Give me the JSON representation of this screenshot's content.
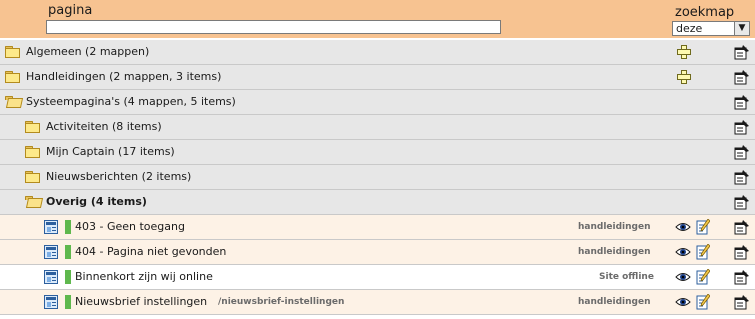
{
  "header": {
    "pagina_label": "pagina",
    "pagina_value": "",
    "zoekmap_label": "zoekmap",
    "zoekmap_value": "deze"
  },
  "rows": [
    {
      "label": "Algemeen (2 mappen)",
      "add": true
    },
    {
      "label": "Handleidingen (2 mappen, 3 items)",
      "add": true
    },
    {
      "label": "Systeempagina's (4 mappen, 5 items)",
      "add": false
    },
    {
      "label": "Activiteiten (8 items)"
    },
    {
      "label": "Mijn Captain (17 items)"
    },
    {
      "label": "Nieuwsberichten (2 items)"
    },
    {
      "label": "Overig (4 items)"
    },
    {
      "label": "403 - Geen toegang",
      "tag": "handleidingen"
    },
    {
      "label": "404 - Pagina niet gevonden",
      "tag": "handleidingen"
    },
    {
      "label": "Binnenkort zijn wij online",
      "tag": "Site offline"
    },
    {
      "label": "Nieuwsbrief instellingen",
      "path": "/nieuwsbrief-instellingen",
      "tag": "handleidingen"
    }
  ],
  "colors": {
    "header_bg": "#f7c391",
    "folder_row_bg": "#e7e7e7",
    "page_row_bg": "#fdf2e6",
    "status_green": "#5fb84d"
  },
  "icons": [
    "folder-icon",
    "folder-open-icon",
    "page-icon",
    "add-icon",
    "view-icon",
    "edit-icon",
    "properties-icon"
  ]
}
